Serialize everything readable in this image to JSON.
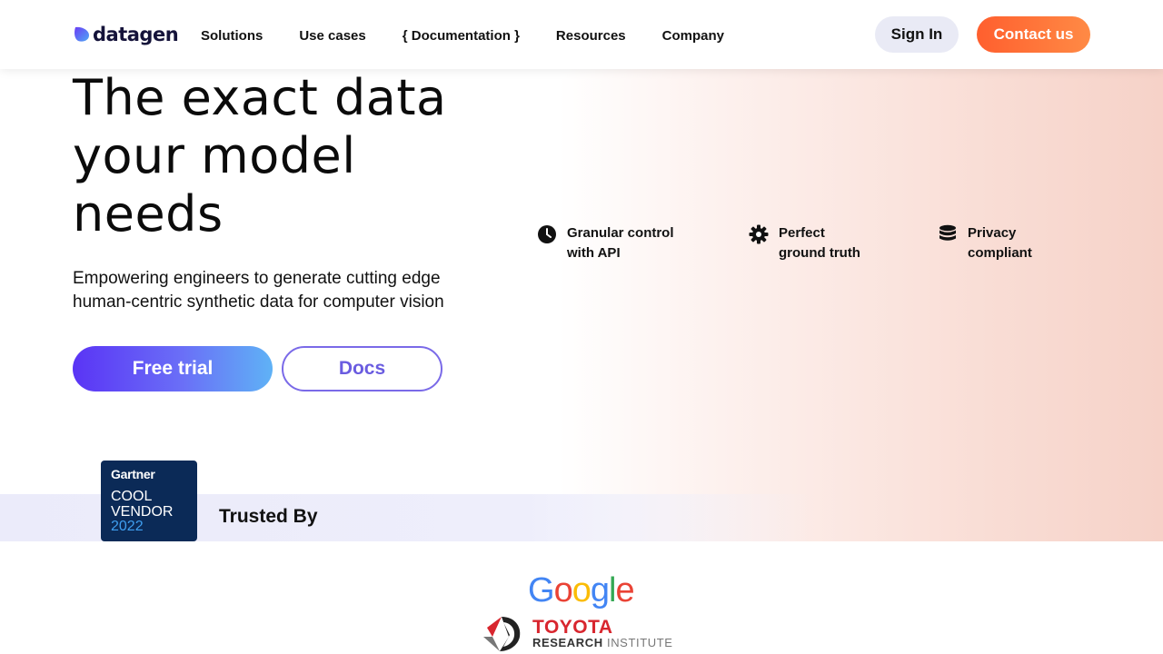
{
  "header": {
    "logo_text": "datagen",
    "nav": [
      "Solutions",
      "Use cases",
      "{ Documentation }",
      "Resources",
      "Company"
    ],
    "signin_label": "Sign In",
    "contact_label": "Contact us",
    "brand_colors": {
      "contact": "#ff6a35",
      "signin_bg": "#e9eaf5"
    }
  },
  "hero": {
    "title": "The exact data your model needs",
    "subtitle": "Empowering engineers to generate cutting edge human-centric synthetic data for computer vision",
    "trial_label": "Free trial",
    "docs_label": "Docs",
    "features": [
      {
        "icon": "clock-icon",
        "text": "Granular control\nwith API"
      },
      {
        "icon": "gear-icon",
        "text": "Perfect\nground truth"
      },
      {
        "icon": "database-icon",
        "text": "Privacy\ncompliant"
      }
    ]
  },
  "trusted": {
    "title": "Trusted By",
    "gartner": {
      "brand": "Gartner",
      "line1": "COOL",
      "line2": "VENDOR",
      "year": "2022"
    },
    "logos": {
      "google": "Google",
      "toyota_name": "TOYOTA",
      "toyota_sub_bold": "RESEARCH",
      "toyota_sub_light": "INSTITUTE"
    }
  }
}
